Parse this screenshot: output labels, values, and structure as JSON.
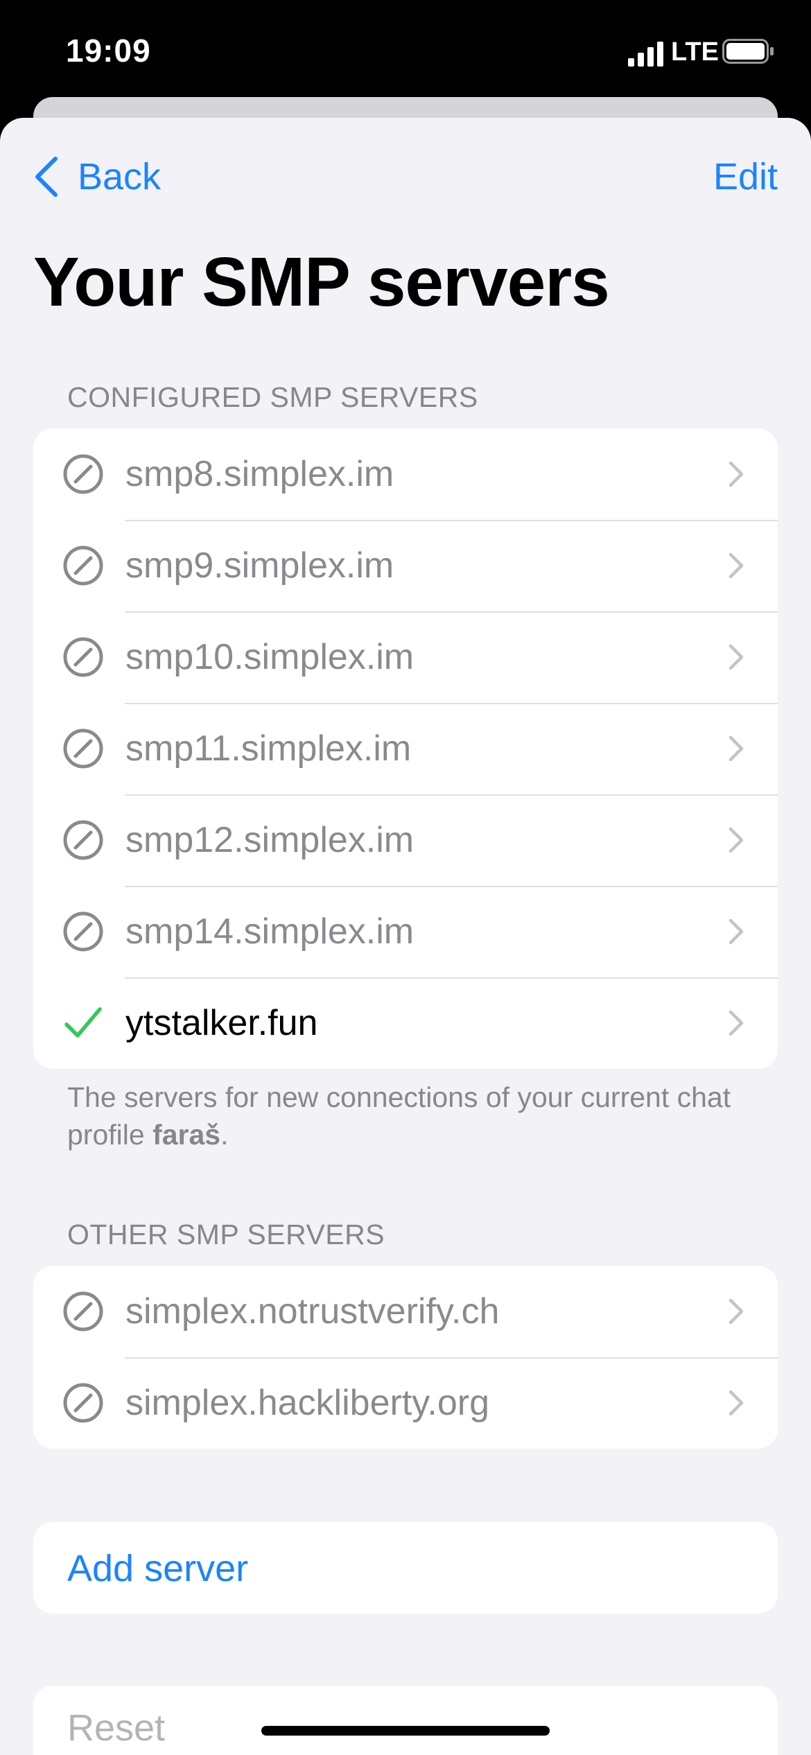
{
  "status_bar": {
    "time": "19:09",
    "network": "LTE",
    "signal_icon": "cellular-signal-icon",
    "battery_icon": "battery-icon"
  },
  "nav": {
    "back_label": "Back",
    "back_icon": "chevron-left-icon",
    "edit_label": "Edit"
  },
  "title": "Your SMP servers",
  "configured": {
    "header": "CONFIGURED SMP SERVERS",
    "servers": [
      {
        "name": "smp8.simplex.im",
        "status_icon": "disabled-circle-icon",
        "enabled": false
      },
      {
        "name": "smp9.simplex.im",
        "status_icon": "disabled-circle-icon",
        "enabled": false
      },
      {
        "name": "smp10.simplex.im",
        "status_icon": "disabled-circle-icon",
        "enabled": false
      },
      {
        "name": "smp11.simplex.im",
        "status_icon": "disabled-circle-icon",
        "enabled": false
      },
      {
        "name": "smp12.simplex.im",
        "status_icon": "disabled-circle-icon",
        "enabled": false
      },
      {
        "name": "smp14.simplex.im",
        "status_icon": "disabled-circle-icon",
        "enabled": false
      },
      {
        "name": "ytstalker.fun",
        "status_icon": "checkmark-icon",
        "enabled": true
      }
    ],
    "footer_prefix": "The servers for new connections of your current chat profile ",
    "footer_profile": "faraš",
    "footer_suffix": "."
  },
  "other": {
    "header": "OTHER SMP SERVERS",
    "servers": [
      {
        "name": "simplex.notrustverify.ch",
        "status_icon": "disabled-circle-icon",
        "enabled": false
      },
      {
        "name": "simplex.hackliberty.org",
        "status_icon": "disabled-circle-icon",
        "enabled": false
      }
    ]
  },
  "actions": {
    "add_server": "Add server",
    "reset": "Reset"
  },
  "colors": {
    "accent": "#1a84ff",
    "enabled_check": "#34c759",
    "disabled_gray": "#8a8a8e",
    "background": "#f2f2f7"
  }
}
